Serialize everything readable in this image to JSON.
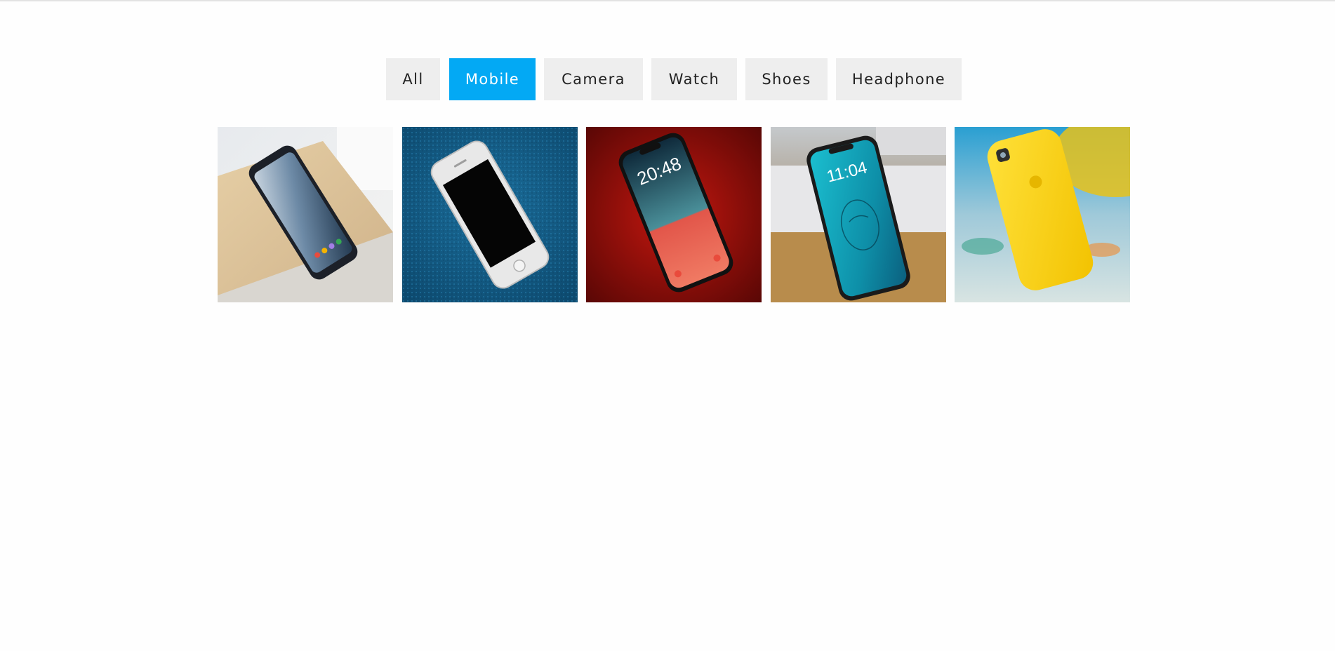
{
  "filters": [
    {
      "label": "All",
      "active": false
    },
    {
      "label": "Mobile",
      "active": true
    },
    {
      "label": "Camera",
      "active": false
    },
    {
      "label": "Watch",
      "active": false
    },
    {
      "label": "Shoes",
      "active": false
    },
    {
      "label": "Headphone",
      "active": false
    }
  ],
  "accent_color": "#03a9f4",
  "gallery": {
    "category": "Mobile",
    "items": [
      {
        "image": "black-android-phone-on-wooden-table"
      },
      {
        "image": "white-iphone-on-blue-carpet"
      },
      {
        "image": "iphone-on-red-background"
      },
      {
        "image": "iphone-x-leaning-on-box"
      },
      {
        "image": "yellow-iphone-case-beach"
      }
    ],
    "lockscreen_times": [
      "20:48",
      "11:04"
    ]
  }
}
